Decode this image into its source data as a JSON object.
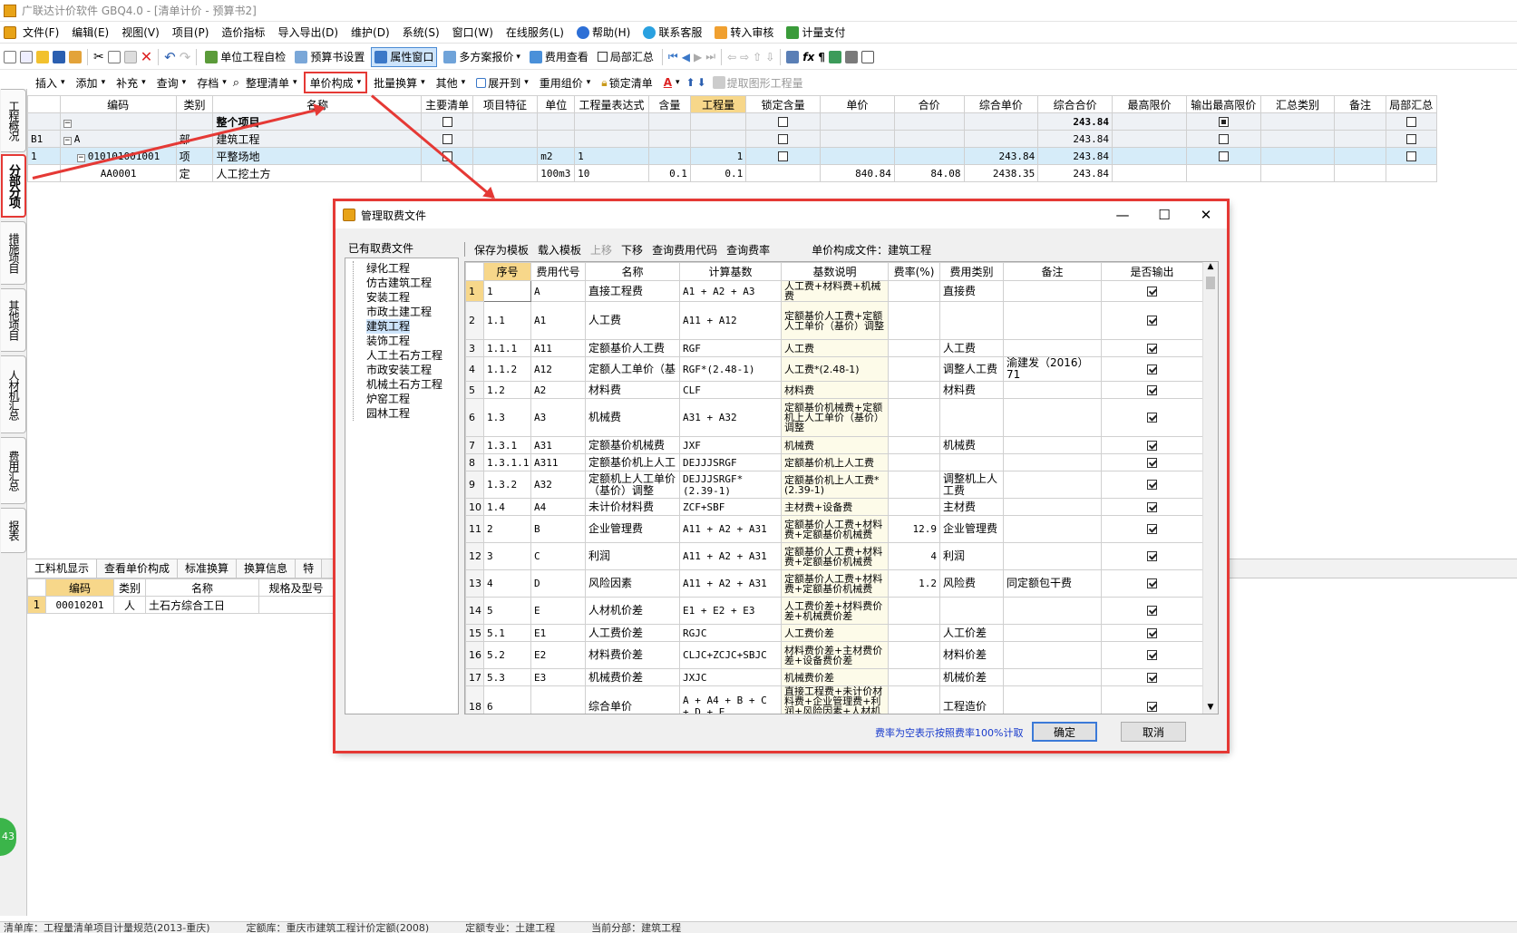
{
  "window": {
    "title": "广联达计价软件 GBQ4.0 - [清单计价 - 预算书2]"
  },
  "menu": [
    "文件(F)",
    "编辑(E)",
    "视图(V)",
    "项目(P)",
    "造价指标",
    "导入导出(D)",
    "维护(D)",
    "系统(S)",
    "窗口(W)",
    "在线服务(L)",
    "帮助(H)",
    "联系客服",
    "转入审核",
    "计量支付"
  ],
  "toolbar1": {
    "unit_check": "单位工程自检",
    "budget_setting": "预算书设置",
    "attr_window": "属性窗口",
    "multi_plan": "多方案报价",
    "fee_view": "费用查看",
    "partial_total": "局部汇总"
  },
  "toolbar2": [
    "插入",
    "添加",
    "补充",
    "查询",
    "存档",
    "整理清单",
    "单价构成",
    "批量换算",
    "其他",
    "展开到",
    "重用组价",
    "锁定清单",
    "提取图形工程量"
  ],
  "left_tabs": [
    "工程概况",
    "分部分项",
    "措施项目",
    "其他项目",
    "人材机汇总",
    "费用汇总",
    "报表"
  ],
  "main_table": {
    "headers": [
      "编码",
      "类别",
      "名称",
      "主要清单",
      "项目特征",
      "单位",
      "工程量表达式",
      "含量",
      "工程量",
      "锁定含量",
      "单价",
      "合价",
      "综合单价",
      "综合合价",
      "最高限价",
      "输出最高限价",
      "汇总类别",
      "备注",
      "局部汇总"
    ],
    "rows": [
      {
        "no": "",
        "code": "",
        "type": "",
        "name": "整个项目",
        "unit": "",
        "expr": "",
        "content": "",
        "qty": "",
        "price": "",
        "total": "",
        "comp_price": "",
        "comp_total": "243.84"
      },
      {
        "no": "B1",
        "code": "A",
        "type": "部",
        "name": "建筑工程",
        "unit": "",
        "expr": "",
        "content": "",
        "qty": "",
        "price": "",
        "total": "",
        "comp_price": "",
        "comp_total": "243.84"
      },
      {
        "no": "1",
        "code": "010101001001",
        "type": "项",
        "name": "平整场地",
        "unit": "m2",
        "expr": "1",
        "content": "",
        "qty": "1",
        "price": "",
        "total": "",
        "comp_price": "243.84",
        "comp_total": "243.84"
      },
      {
        "no": "",
        "code": "AA0001",
        "type": "定",
        "name": "人工挖土方",
        "unit": "100m3",
        "expr": "10",
        "content": "0.1",
        "qty": "0.1",
        "price": "840.84",
        "total": "84.08",
        "comp_price": "2438.35",
        "comp_total": "243.84"
      }
    ]
  },
  "bottom_tabs": [
    "工料机显示",
    "查看单价构成",
    "标准换算",
    "换算信息",
    "特"
  ],
  "bottom_table": {
    "headers": [
      "编码",
      "类别",
      "名称",
      "规格及型号"
    ],
    "rows": [
      {
        "no": "1",
        "code": "00010201",
        "type": "人",
        "name": "土石方综合工日"
      }
    ]
  },
  "status": [
    "清单库：工程量清单项目计量规范(2013-重庆)",
    "定额库：重庆市建筑工程计价定额(2008)",
    "定额专业：土建工程",
    "当前分部：建筑工程"
  ],
  "badge": "43",
  "dialog": {
    "title": "管理取费文件",
    "left_title": "已有取费文件",
    "files": [
      "绿化工程",
      "仿古建筑工程",
      "安装工程",
      "市政土建工程",
      "建筑工程",
      "装饰工程",
      "人工土石方工程",
      "市政安装工程",
      "机械土石方工程",
      "炉窑工程",
      "园林工程"
    ],
    "selected_file": "建筑工程",
    "toolbar": [
      "保存为模板",
      "载入模板",
      "上移",
      "下移",
      "查询费用代码",
      "查询费率"
    ],
    "file_label": "单价构成文件：建筑工程",
    "headers": [
      "序号",
      "费用代号",
      "名称",
      "计算基数",
      "基数说明",
      "费率(%)",
      "费用类别",
      "备注",
      "是否输出"
    ],
    "rows": [
      {
        "n": "1",
        "seq": "1",
        "code": "A",
        "name": "直接工程费",
        "base": "A1 + A2 + A3",
        "desc": "人工费+材料费+机械费",
        "rate": "",
        "cat": "直接费",
        "note": ""
      },
      {
        "n": "2",
        "seq": "1.1",
        "code": "A1",
        "name": "人工费",
        "base": "A11 + A12",
        "desc": "定额基价人工费+定额人工单价（基价）调整",
        "rate": "",
        "cat": "",
        "note": ""
      },
      {
        "n": "3",
        "seq": "1.1.1",
        "code": "A11",
        "name": "定额基价人工费",
        "base": "RGF",
        "desc": "人工费",
        "rate": "",
        "cat": "人工费",
        "note": ""
      },
      {
        "n": "4",
        "seq": "1.1.2",
        "code": "A12",
        "name": "定额人工单价（基",
        "base": "RGF*(2.48-1)",
        "desc": "人工费*(2.48-1)",
        "rate": "",
        "cat": "调整人工费",
        "note": "渝建发（2016）71"
      },
      {
        "n": "5",
        "seq": "1.2",
        "code": "A2",
        "name": "材料费",
        "base": "CLF",
        "desc": "材料费",
        "rate": "",
        "cat": "材料费",
        "note": ""
      },
      {
        "n": "6",
        "seq": "1.3",
        "code": "A3",
        "name": "机械费",
        "base": "A31 + A32",
        "desc": "定额基价机械费+定额机上人工单价（基价）调整",
        "rate": "",
        "cat": "",
        "note": ""
      },
      {
        "n": "7",
        "seq": "1.3.1",
        "code": "A31",
        "name": "定额基价机械费",
        "base": "JXF",
        "desc": "机械费",
        "rate": "",
        "cat": "机械费",
        "note": ""
      },
      {
        "n": "8",
        "seq": "1.3.1.1",
        "code": "A311",
        "name": "定额基价机上人工",
        "base": "DEJJJSRGF",
        "desc": "定额基价机上人工费",
        "rate": "",
        "cat": "",
        "note": ""
      },
      {
        "n": "9",
        "seq": "1.3.2",
        "code": "A32",
        "name": "定额机上人工单价（基价）调整",
        "base": "DEJJJSRGF*(2.39-1)",
        "desc": "定额基价机上人工费*(2.39-1)",
        "rate": "",
        "cat": "调整机上人工费",
        "note": ""
      },
      {
        "n": "10",
        "seq": "1.4",
        "code": "A4",
        "name": "未计价材料费",
        "base": "ZCF+SBF",
        "desc": "主材费+设备费",
        "rate": "",
        "cat": "主材费",
        "note": ""
      },
      {
        "n": "11",
        "seq": "2",
        "code": "B",
        "name": "企业管理费",
        "base": "A11 + A2 + A31",
        "desc": "定额基价人工费+材料费+定额基价机械费",
        "rate": "12.9",
        "cat": "企业管理费",
        "note": ""
      },
      {
        "n": "12",
        "seq": "3",
        "code": "C",
        "name": "利润",
        "base": "A11 + A2 + A31",
        "desc": "定额基价人工费+材料费+定额基价机械费",
        "rate": "4",
        "cat": "利润",
        "note": ""
      },
      {
        "n": "13",
        "seq": "4",
        "code": "D",
        "name": "风险因素",
        "base": "A11 + A2 + A31",
        "desc": "定额基价人工费+材料费+定额基价机械费",
        "rate": "1.2",
        "cat": "风险费",
        "note": "同定额包干费"
      },
      {
        "n": "14",
        "seq": "5",
        "code": "E",
        "name": "人材机价差",
        "base": "E1 + E2 + E3",
        "desc": "人工费价差+材料费价差+机械费价差",
        "rate": "",
        "cat": "",
        "note": ""
      },
      {
        "n": "15",
        "seq": "5.1",
        "code": "E1",
        "name": "人工费价差",
        "base": "RGJC",
        "desc": "人工费价差",
        "rate": "",
        "cat": "人工价差",
        "note": ""
      },
      {
        "n": "16",
        "seq": "5.2",
        "code": "E2",
        "name": "材料费价差",
        "base": "CLJC+ZCJC+SBJC",
        "desc": "材料费价差+主材费价差+设备费价差",
        "rate": "",
        "cat": "材料价差",
        "note": ""
      },
      {
        "n": "17",
        "seq": "5.3",
        "code": "E3",
        "name": "机械费价差",
        "base": "JXJC",
        "desc": "机械费价差",
        "rate": "",
        "cat": "机械价差",
        "note": ""
      },
      {
        "n": "18",
        "seq": "6",
        "code": "",
        "name": "综合单价",
        "base": "A + A4 + B + C + D + E",
        "desc": "直接工程费+未计价材料费+企业管理费+利润+风险因素+人材机价",
        "rate": "",
        "cat": "工程造价",
        "note": ""
      }
    ],
    "hint": "费率为空表示按照费率100%计取",
    "ok": "确定",
    "cancel": "取消"
  },
  "colors": {
    "accent": "#e53935",
    "select": "#d6ecf9",
    "hint": "#1a3ccc"
  }
}
